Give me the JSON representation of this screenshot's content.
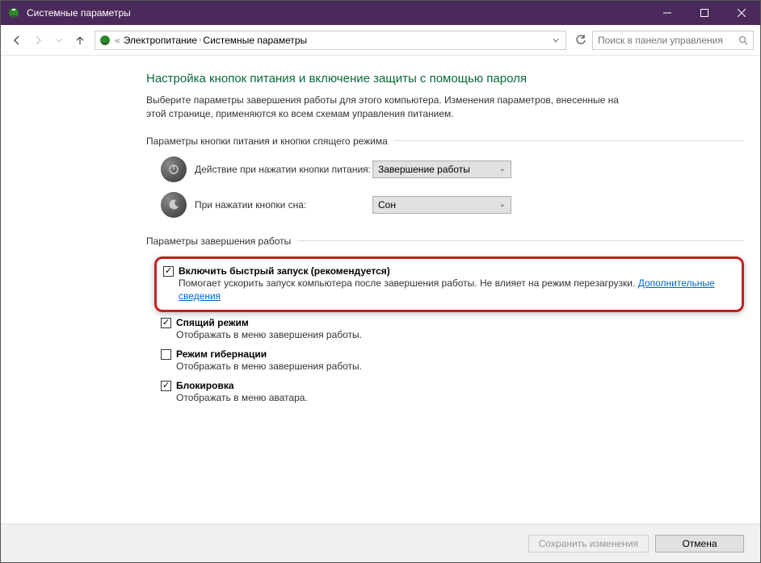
{
  "titlebar": {
    "title": "Системные параметры"
  },
  "nav": {
    "breadcrumb_prefix": "«",
    "crumb1": "Электропитание",
    "crumb2": "Системные параметры",
    "search_placeholder": "Поиск в панели управления"
  },
  "page": {
    "title": "Настройка кнопок питания и включение защиты с помощью пароля",
    "desc": "Выберите параметры завершения работы для этого компьютера. Изменения параметров, внесенные на этой странице, применяются ко всем схемам управления питанием."
  },
  "section1": {
    "header": "Параметры кнопки питания и кнопки спящего режима",
    "power_label": "Действие при нажатии кнопки питания:",
    "power_value": "Завершение работы",
    "sleep_label": "При нажатии кнопки сна:",
    "sleep_value": "Сон"
  },
  "section2": {
    "header": "Параметры завершения работы",
    "opt1_title": "Включить быстрый запуск (рекомендуется)",
    "opt1_desc_a": "Помогает ускорить запуск компьютера после завершения работы. Не влияет на режим перезагрузки. ",
    "opt1_link": "Дополнительные сведения",
    "opt2_title": "Спящий режим",
    "opt2_desc": "Отображать в меню завершения работы.",
    "opt3_title": "Режим гибернации",
    "opt3_desc": "Отображать в меню завершения работы.",
    "opt4_title": "Блокировка",
    "opt4_desc": "Отображать в меню аватара."
  },
  "footer": {
    "save": "Сохранить изменения",
    "cancel": "Отмена"
  }
}
